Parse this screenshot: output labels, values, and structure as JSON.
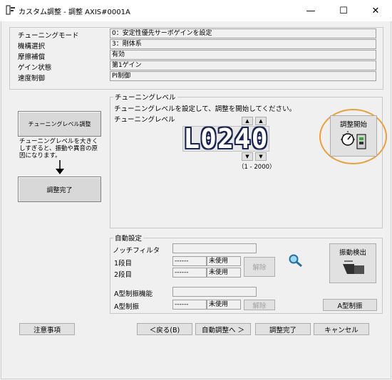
{
  "window": {
    "title": "カスタム調整 - 調整 AXIS#0001A",
    "minimize": "—",
    "maximize": "☐",
    "close": "✕"
  },
  "info": {
    "tuning_mode_label": "チューニングモード",
    "tuning_mode_value": "0：安定性優先サーボゲインを設定",
    "rows": [
      {
        "label": "機構選択",
        "value": "3：剛体系"
      },
      {
        "label": "摩擦補償",
        "value": "有効"
      },
      {
        "label": "ゲイン状態",
        "value": "第1ゲイン"
      },
      {
        "label": "速度制御",
        "value": "PI制御"
      }
    ]
  },
  "flow": {
    "step1": "チューニングレベル調整",
    "note": "チューニングレベルを大きくしすぎると、振動や異音の原因になります。",
    "step2": "調整完了"
  },
  "tuning": {
    "group_title": "チューニングレベル",
    "instruction": "チューニングレベルを設定して、調整を開始してください。",
    "level_label": "チューニングレベル",
    "display_value": "L0240",
    "range": "（1 - 2000）",
    "up": "▲",
    "down": "▼",
    "start_label": "調整開始"
  },
  "auto": {
    "group_title": "自動設定",
    "notch_label": "ノッチフィルタ",
    "stage1_label": "1段目",
    "stage2_label": "2段目",
    "stage1_value": "------",
    "stage2_value": "------",
    "stage1_status": "未使用",
    "stage2_status": "未使用",
    "release1": "解除",
    "vib_detect": "振動検出",
    "a_type_func_label": "A型制振機能",
    "a_type_label": "A型制振",
    "a_type_value": "------",
    "a_type_status": "未使用",
    "release2": "解除",
    "a_type_button": "A型制振"
  },
  "footer": {
    "caution": "注意事項",
    "back": "＜戻る(B)",
    "auto_adjust": "自動調整へ ＞",
    "complete": "調整完了",
    "cancel": "キャンセル"
  },
  "colors": {
    "highlight_circle": "#e8a040",
    "segment_blue": "#1a2550"
  }
}
